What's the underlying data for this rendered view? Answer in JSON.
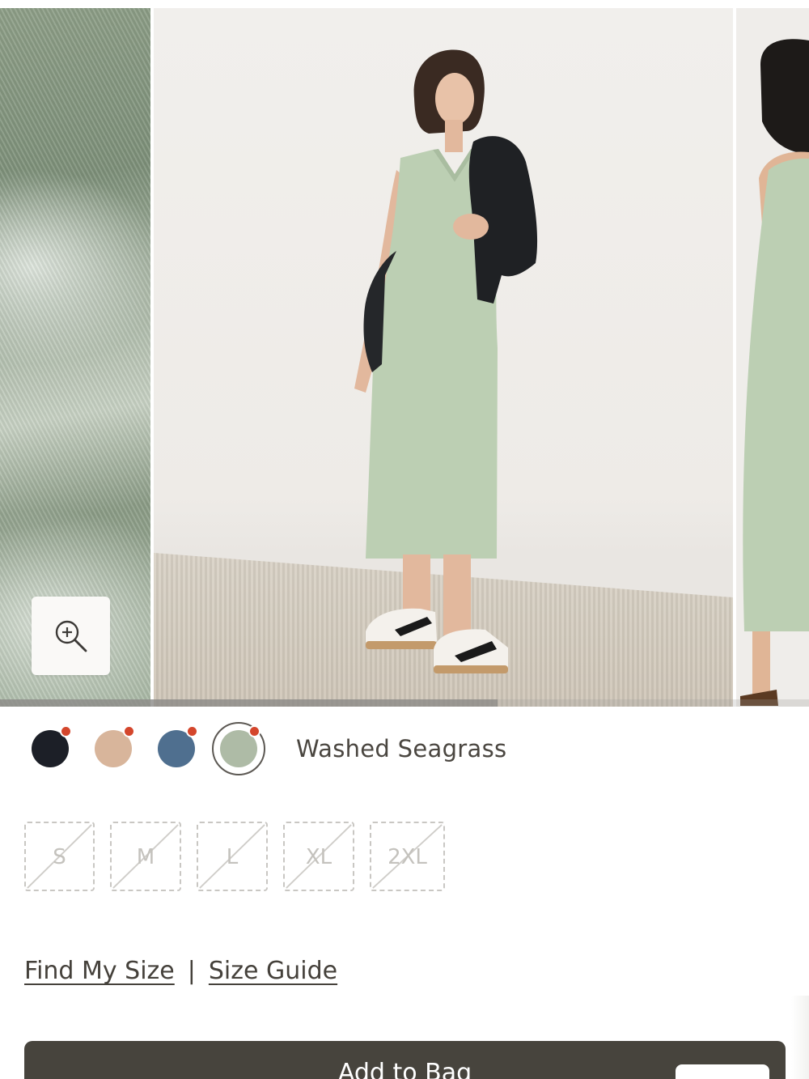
{
  "gallery": {
    "images": [
      {
        "name": "fabric-closeup"
      },
      {
        "name": "model-full-length"
      },
      {
        "name": "model-side-view"
      }
    ],
    "zoom_icon": "zoom-in-icon",
    "progress_fraction": 0.615
  },
  "colors": {
    "selected_label": "Washed Seagrass",
    "swatches": [
      {
        "name": "navy",
        "color": "#1c1f27",
        "unavailable_marker": true
      },
      {
        "name": "tan",
        "color": "#d8b59b",
        "unavailable_marker": true
      },
      {
        "name": "blue",
        "color": "#4f6f8f",
        "unavailable_marker": true
      },
      {
        "name": "seagrass",
        "color": "#aebba6",
        "unavailable_marker": true,
        "selected": true
      }
    ],
    "marker_color": "#d4462c"
  },
  "sizes": [
    {
      "label": "S",
      "available": false
    },
    {
      "label": "M",
      "available": false
    },
    {
      "label": "L",
      "available": false
    },
    {
      "label": "XL",
      "available": false
    },
    {
      "label": "2XL",
      "available": false
    }
  ],
  "links": {
    "find_my_size": "Find My Size",
    "separator": "|",
    "size_guide": "Size Guide"
  },
  "cta": {
    "add_to_bag": "Add to Bag",
    "color": "#47443d"
  }
}
